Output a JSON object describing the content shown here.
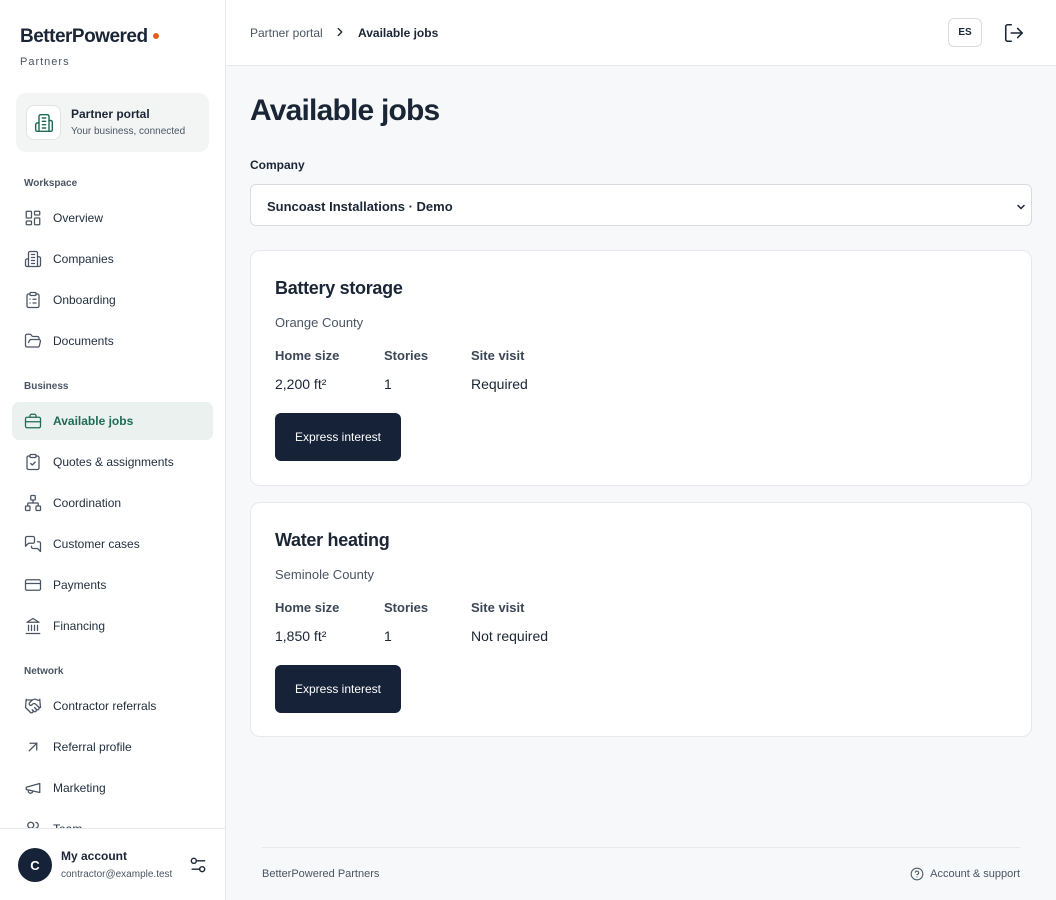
{
  "brand": {
    "name": "BetterPowered",
    "sub": "Partners",
    "accent": "#e0601f"
  },
  "portal": {
    "title": "Partner portal",
    "subtitle": "Your business, connected"
  },
  "sidebar": {
    "sections": [
      {
        "label": "Workspace",
        "items": [
          {
            "label": "Overview",
            "icon": "grid-icon"
          },
          {
            "label": "Companies",
            "icon": "building-icon"
          },
          {
            "label": "Onboarding",
            "icon": "clipboard-icon"
          },
          {
            "label": "Documents",
            "icon": "folder-icon"
          }
        ]
      },
      {
        "label": "Business",
        "items": [
          {
            "label": "Available jobs",
            "icon": "briefcase-icon",
            "active": true
          },
          {
            "label": "Quotes & assignments",
            "icon": "clipboard-check-icon"
          },
          {
            "label": "Coordination",
            "icon": "network-icon"
          },
          {
            "label": "Customer cases",
            "icon": "chat-icon"
          },
          {
            "label": "Payments",
            "icon": "credit-card-icon"
          },
          {
            "label": "Financing",
            "icon": "bank-icon"
          }
        ]
      },
      {
        "label": "Network",
        "items": [
          {
            "label": "Contractor referrals",
            "icon": "handshake-icon"
          },
          {
            "label": "Referral profile",
            "icon": "arrow-up-right-icon"
          },
          {
            "label": "Marketing",
            "icon": "megaphone-icon"
          },
          {
            "label": "Team",
            "icon": "users-icon"
          }
        ]
      }
    ]
  },
  "account": {
    "initial": "C",
    "name": "My account",
    "email": "contractor@example.test"
  },
  "breadcrumb": {
    "parent": "Partner portal",
    "current": "Available jobs"
  },
  "topbar": {
    "language": "ES"
  },
  "main": {
    "title": "Available jobs",
    "company_label": "Company",
    "company_selected": "Suncoast Installations · Demo",
    "jobs": [
      {
        "title": "Battery storage",
        "region": "Orange County",
        "attributes": [
          {
            "label": "Home size",
            "value": "2,200 ft²"
          },
          {
            "label": "Stories",
            "value": "1"
          },
          {
            "label": "Site visit",
            "value": "Required"
          }
        ],
        "action": "Express interest"
      },
      {
        "title": "Water heating",
        "region": "Seminole County",
        "attributes": [
          {
            "label": "Home size",
            "value": "1,850 ft²"
          },
          {
            "label": "Stories",
            "value": "1"
          },
          {
            "label": "Site visit",
            "value": "Not required"
          }
        ],
        "action": "Express interest"
      }
    ]
  },
  "footer": {
    "left": "BetterPowered Partners",
    "right": "Account & support"
  },
  "colors": {
    "primary": "#152238",
    "active_bg": "#eaf1ef",
    "active_text": "#1f6b56"
  }
}
